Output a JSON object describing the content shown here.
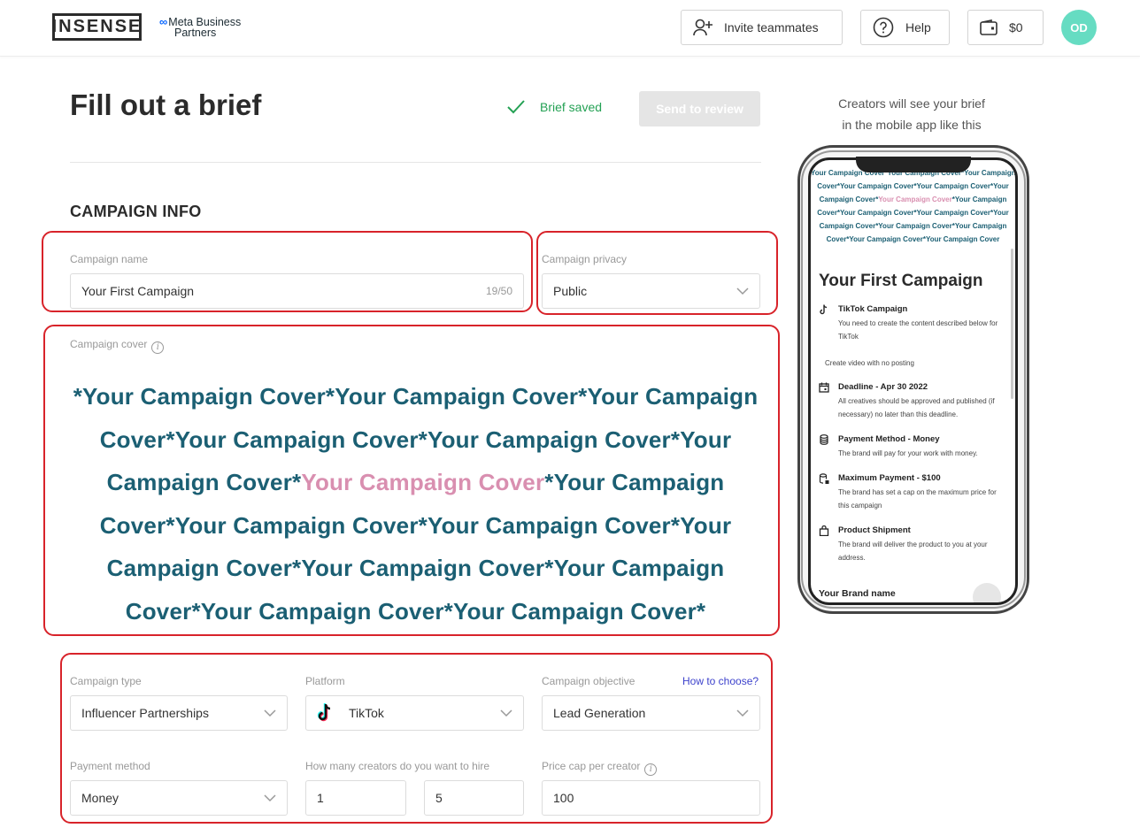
{
  "header": {
    "logo": "INSENSE",
    "partner_line1": "Meta Business",
    "partner_line2": "Partners",
    "invite_label": "Invite teammates",
    "help_label": "Help",
    "wallet_label": "$0",
    "avatar_initials": "OD"
  },
  "page": {
    "title": "Fill out a brief",
    "saved_status": "Brief saved",
    "send_label": "Send to review",
    "section_title": "CAMPAIGN INFO"
  },
  "form": {
    "campaign_name": {
      "label": "Campaign name",
      "value": "Your First Campaign",
      "counter": "19/50"
    },
    "campaign_privacy": {
      "label": "Campaign privacy",
      "value": "Public"
    },
    "campaign_cover": {
      "label": "Campaign cover"
    },
    "campaign_type": {
      "label": "Campaign type",
      "value": "Influencer Partnerships"
    },
    "platform": {
      "label": "Platform",
      "value": "TikTok"
    },
    "campaign_objective": {
      "label": "Campaign objective",
      "value": "Lead Generation",
      "help_link": "How to choose?"
    },
    "payment_method": {
      "label": "Payment method",
      "value": "Money"
    },
    "creators": {
      "label": "How many creators do you want to hire",
      "min": "1",
      "max": "5"
    },
    "price_cap": {
      "label": "Price cap per creator",
      "value": "100"
    }
  },
  "cover": {
    "lines": [
      [
        "*Your Campaign Cover*Your Campaign Cover*Your Campaign",
        "",
        ""
      ],
      [
        "Cover*Your Campaign Cover*Your Campaign Cover*Your",
        "",
        ""
      ],
      [
        "Campaign Cover*",
        "Your Campaign Cover",
        "*Your Campaign"
      ],
      [
        "Cover*Your Campaign Cover*Your Campaign Cover*Your",
        "",
        ""
      ],
      [
        "Campaign Cover*Your Campaign Cover*Your Campaign",
        "",
        ""
      ],
      [
        "Cover*Your Campaign Cover*Your Campaign Cover*",
        "",
        ""
      ]
    ]
  },
  "preview": {
    "caption_line1": "Creators will see your brief",
    "caption_line2": "in the mobile app like this",
    "mini_cover": [
      [
        "Your Campaign Cover*Your Campaign Cover*Your Campaign",
        "",
        ""
      ],
      [
        "Cover*Your Campaign Cover*Your Campaign Cover*Your",
        "",
        ""
      ],
      [
        "Campaign Cover*",
        "Your Campaign Cover",
        "*Your Campaign"
      ],
      [
        "Cover*Your Campaign Cover*Your Campaign Cover*Your",
        "",
        ""
      ],
      [
        "Campaign Cover*Your Campaign Cover*Your Campaign",
        "",
        ""
      ],
      [
        "Cover*Your Campaign Cover*Your Campaign Cover",
        "",
        ""
      ]
    ],
    "title": "Your First Campaign",
    "platform_title": "TikTok Campaign",
    "platform_desc": "You need to create the content described below for TikTok",
    "posting_note": "Create video with no posting",
    "deadline_title": "Deadline - Apr 30 2022",
    "deadline_desc": "All creatives should be approved and published (if necessary) no later than this deadline.",
    "payment_title": "Payment Method - Money",
    "payment_desc": "The brand will pay for your work with money.",
    "max_title": "Maximum Payment - $100",
    "max_desc": "The brand has set a cap on the maximum price for this campaign",
    "shipment_title": "Product Shipment",
    "shipment_desc": "The brand will deliver the product to you at your address.",
    "brand_name": "Your Brand name"
  },
  "colors": {
    "accent_green": "#24a154",
    "avatar": "#66dcc2",
    "annotation_red": "#d8232a",
    "link_blue": "#3d42cc",
    "cover_teal": "#1b5f73",
    "cover_pink": "#d98fb0"
  }
}
